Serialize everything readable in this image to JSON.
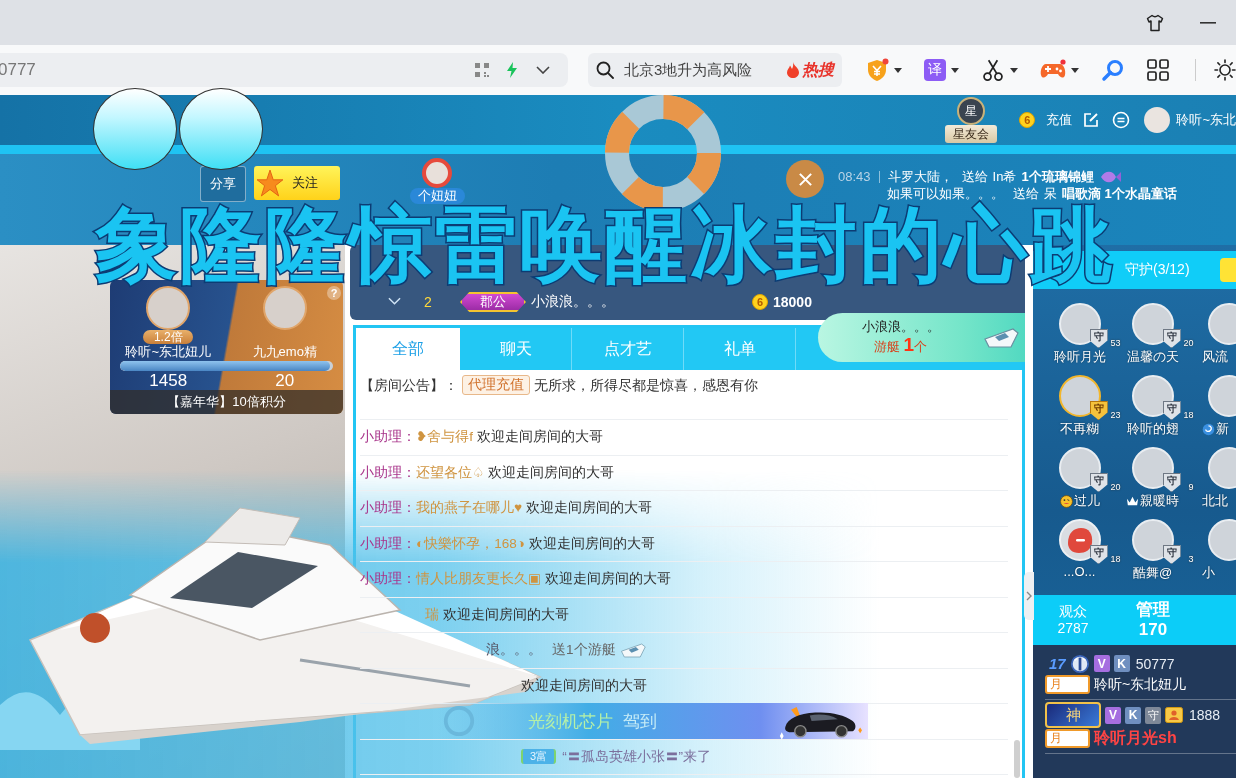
{
  "browser": {
    "address": "0777",
    "search": {
      "placeholder": "北京3地升为高风险",
      "hot": "热搜"
    },
    "translate_label": "译"
  },
  "overlay": {
    "title": "象隆隆惊雷唤醒冰封的心跳"
  },
  "site_header": {
    "club": {
      "emblem": "星",
      "label": "星友会"
    },
    "coin_mark": "6",
    "recharge": "充值",
    "username": "聆听~东北"
  },
  "room_header": {
    "share": "分享",
    "follow": "关注",
    "host": "个妞妞",
    "ticker": [
      {
        "kind": "iconed",
        "time": "08:43",
        "sender": "斗罗大陆，",
        "verb": "送给",
        "receiver": "In希",
        "gift": "1个琉璃锦鲤"
      },
      {
        "kind": "plain",
        "sender": "如果可以如果。。。",
        "verb": "送给",
        "receiver": "呆",
        "gift": "唱歌滴 1个水晶童话"
      }
    ]
  },
  "pk": {
    "left": {
      "name": "聆听~东北妞儿",
      "score": "1458",
      "multiplier": "1.2倍"
    },
    "right": {
      "name": "九九emo精",
      "score": "20"
    },
    "level": 0.986,
    "help": "?",
    "bonus": "【嘉年华】10倍积分"
  },
  "rank": {
    "rows": [
      {
        "place": "2",
        "title": "郡公",
        "name": "小浪浪。。。",
        "coin_mark": "6",
        "amount": "18000"
      }
    ]
  },
  "gift_popup": {
    "sender": "小浪浪。。。",
    "gift_line": "游艇 **1**个"
  },
  "chat": {
    "tabs": [
      {
        "label": "全部",
        "selected": true
      },
      {
        "label": "聊天",
        "selected": false
      },
      {
        "label": "点才艺",
        "selected": false
      },
      {
        "label": "礼单",
        "selected": false
      }
    ],
    "announcement": {
      "label": "【房间公告】：",
      "tag": "代理充值",
      "text": "无所求，所得尽都是惊喜，感恩有你"
    },
    "messages": [
      {
        "kind": "welcome",
        "speaker": "小助理：",
        "name": "❥舍与得f",
        "text": "欢迎走间房间的大哥"
      },
      {
        "kind": "welcome",
        "speaker": "小助理：",
        "name": "还望各位♤",
        "text": "欢迎走间房间的大哥"
      },
      {
        "kind": "welcome",
        "speaker": "小助理：",
        "name": "我的燕子在哪儿♥",
        "text": "欢迎走间房间的大哥"
      },
      {
        "kind": "welcome",
        "speaker": "小助理：",
        "name": "◐快樂怀孕，168◑",
        "text": "欢迎走间房间的大哥"
      },
      {
        "kind": "welcome",
        "speaker": "小助理：",
        "name": "情人比朋友更长久▣",
        "text": "欢迎走间房间的大哥"
      },
      {
        "kind": "welcome",
        "name": "瑞",
        "text": "欢迎走间房间的大哥"
      },
      {
        "kind": "gift",
        "name": "浪。。。",
        "text": "送1个游艇"
      },
      {
        "kind": "welcome",
        "text": "欢迎走间房间的大哥"
      },
      {
        "kind": "entrance",
        "name": "光刻机芯片",
        "text": "驾到"
      },
      {
        "kind": "arrival",
        "badge": "3富",
        "text": "“〓孤岛英雄小张〓”来了"
      }
    ]
  },
  "right_panel": {
    "guard": {
      "title": "守护(3/12)",
      "members": [
        {
          "kind": "plain",
          "name": "聆听月光",
          "mark": "守",
          "level": "53",
          "gold": false
        },
        {
          "kind": "plain",
          "name": "温馨の天",
          "mark": "守",
          "level": "20",
          "gold": false
        },
        {
          "kind": "plain",
          "name": "风流"
        },
        {
          "kind": "plain",
          "name": "不再糊",
          "mark": "守",
          "level": "23",
          "gold": true
        },
        {
          "kind": "plain",
          "name": "聆听的翅",
          "mark": "守",
          "level": "18",
          "gold": false
        },
        {
          "kind": "swirl",
          "name": "新"
        },
        {
          "kind": "emoji",
          "name": "过儿",
          "mark": "守",
          "level": "20",
          "gold": false
        },
        {
          "kind": "crown",
          "name": "親暖時",
          "mark": "守",
          "level": "9",
          "gold": false
        },
        {
          "kind": "plain",
          "name": "北北"
        },
        {
          "kind": "mascot",
          "name": "...O...",
          "mark": "守",
          "level": "18",
          "gold": false
        },
        {
          "kind": "plain",
          "name": "酷舞@",
          "mark": "守",
          "level": "3",
          "gold": false
        },
        {
          "kind": "plain",
          "name": "小"
        }
      ]
    },
    "stats": [
      {
        "label": "观众",
        "value": "2787",
        "selected": false
      },
      {
        "label": "管理",
        "value": "170",
        "selected": true
      }
    ],
    "users": [
      {
        "level": "17",
        "badges": [
          {
            "kind": "emblem"
          },
          {
            "kind": "vip",
            "text": "V"
          },
          {
            "kind": "k",
            "text": "K"
          }
        ],
        "score": "50777",
        "month": "月",
        "name": "聆听~东北妞儿",
        "highlight": false
      },
      {
        "badges": [
          {
            "kind": "god",
            "text": "神"
          },
          {
            "kind": "vip",
            "text": "V"
          },
          {
            "kind": "k",
            "text": "K"
          },
          {
            "kind": "guard",
            "text": "守"
          },
          {
            "kind": "host"
          }
        ],
        "score": "1888",
        "month": "月",
        "name": "聆听月光sh",
        "highlight": true
      }
    ]
  }
}
